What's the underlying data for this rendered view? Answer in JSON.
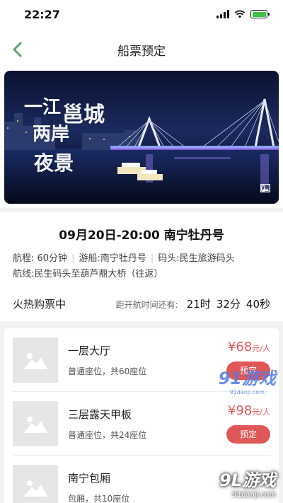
{
  "status": {
    "time": "22:27"
  },
  "nav": {
    "title": "船票预定"
  },
  "banner": {
    "photo_count": "0",
    "calligraphy": [
      "一江",
      "两岸",
      "邕城",
      "夜景"
    ]
  },
  "trip": {
    "title": "09月20日-20:00 南宁牡丹号",
    "duration": "航程: 60分钟",
    "boat": "游船:南宁牡丹号",
    "pier": "码头:民生旅游码头",
    "route": "航线:民生码头至葫芦鼎大桥（往返）"
  },
  "sale": {
    "label": "火热购票中",
    "countdown_label": "距开航时间还有:",
    "hours": "21时",
    "minutes": "32分",
    "seconds": "40秒"
  },
  "tickets": [
    {
      "name": "一层大厅",
      "desc": "普通座位，共60座位",
      "price": "¥68",
      "unit": "元/人",
      "button": "预定"
    },
    {
      "name": "三层露天甲板",
      "desc": "普通座位，共24座位",
      "price": "¥98",
      "unit": "元/人",
      "button": "预定"
    },
    {
      "name": "南宁包厢",
      "desc": "包厢，共10座位",
      "price": "",
      "unit": "",
      "button": ""
    }
  ],
  "watermarks": {
    "mid": "91游戏",
    "mid_url": "91danji.com",
    "bottom": "9L游戏",
    "bottom_url": "91danji.com"
  },
  "colors": {
    "accent_green": "#5aa46a",
    "price_red": "#e05757",
    "battery_green": "#3cc24a"
  }
}
